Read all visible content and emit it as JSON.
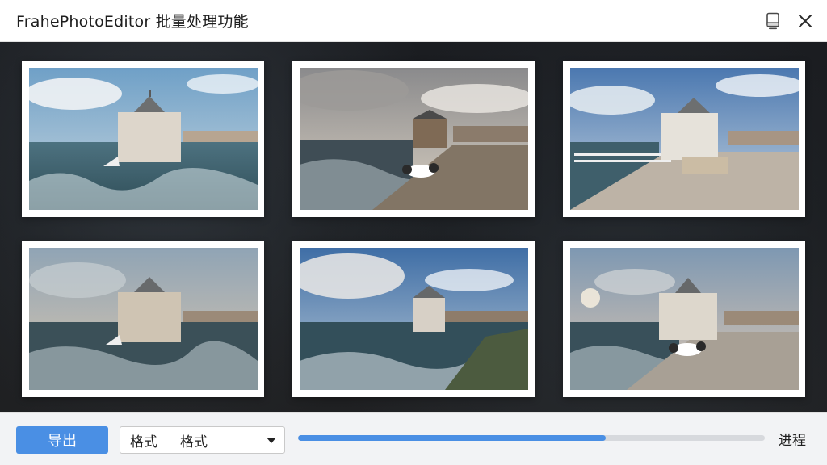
{
  "window": {
    "title": "FrahePhotoEditor 批量处理功能"
  },
  "toolbar": {
    "export_label": "导出",
    "format_label": "格式",
    "format_value": "格式",
    "progress_label": "进程"
  },
  "progress": {
    "value": 0.66
  },
  "colors": {
    "accent": "#4a8fe4",
    "titlebar": "#ffffff",
    "bottombar": "#f2f3f5",
    "content_bg": "#1b1d21"
  },
  "icons": {
    "minimize": "minimize-icon",
    "close": "close-icon",
    "dropdown": "chevron-down-icon"
  }
}
